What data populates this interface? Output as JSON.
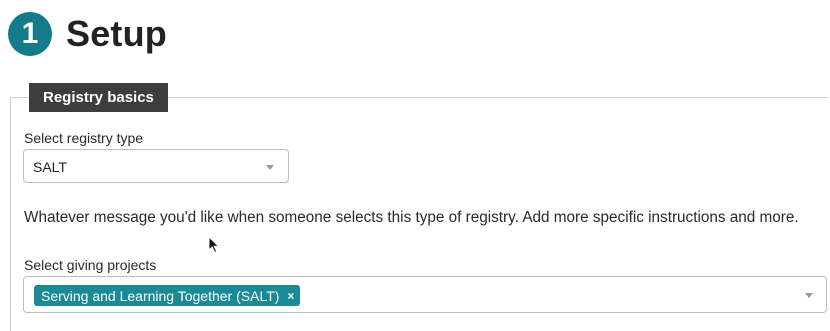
{
  "header": {
    "step_number": "1",
    "title": "Setup"
  },
  "section": {
    "legend": "Registry basics"
  },
  "registry_type": {
    "label": "Select registry type",
    "selected": "SALT"
  },
  "message": "Whatever message you'd like when someone selects this type of registry. Add more specific instructions and more.",
  "giving_projects": {
    "label": "Select giving projects",
    "tags": [
      {
        "label": "Serving and Learning Together (SALT)",
        "remove": "×"
      }
    ]
  },
  "colors": {
    "accent": "#137b8a",
    "tag": "#1a8a97",
    "legend_bg": "#3d3d3d"
  },
  "icons": {
    "dropdown": "chevron-down-icon",
    "cursor": "mouse-pointer-icon"
  }
}
